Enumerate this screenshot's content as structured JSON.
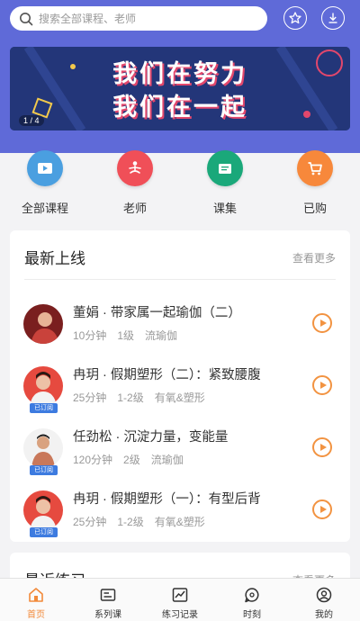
{
  "search": {
    "placeholder": "搜索全部课程、老师"
  },
  "banner": {
    "line1": "我们在努力",
    "line2": "我们在一起",
    "pager": "1 / 4"
  },
  "categories": [
    {
      "label": "全部课程",
      "icon": "video-icon",
      "color": "#4a9fe0"
    },
    {
      "label": "老师",
      "icon": "meditation-icon",
      "color": "#f04f58"
    },
    {
      "label": "课集",
      "icon": "folder-icon",
      "color": "#1aa87a"
    },
    {
      "label": "已购",
      "icon": "cart-icon",
      "color": "#f7883b"
    }
  ],
  "latest": {
    "title": "最新上线",
    "more": "查看更多",
    "items": [
      {
        "title": "董娟 · 带家属一起瑜伽（二）",
        "duration": "10分钟",
        "level": "1级",
        "style": "流瑜伽",
        "badge": ""
      },
      {
        "title": "冉玥 · 假期塑形（二）：紧致腰腹",
        "duration": "25分钟",
        "level": "1-2级",
        "style": "有氧&塑形",
        "badge": "已订阅"
      },
      {
        "title": "任劲松 · 沉淀力量，变能量",
        "duration": "120分钟",
        "level": "2级",
        "style": "流瑜伽",
        "badge": "已订阅"
      },
      {
        "title": "冉玥 · 假期塑形（一）：有型后背",
        "duration": "25分钟",
        "level": "1-2级",
        "style": "有氧&塑形",
        "badge": "已订阅"
      }
    ]
  },
  "recent": {
    "title": "最近练习",
    "more": "查看更多"
  },
  "tabs": [
    {
      "label": "首页",
      "icon": "home-icon",
      "active": true
    },
    {
      "label": "系列课",
      "icon": "series-icon",
      "active": false
    },
    {
      "label": "练习记录",
      "icon": "chart-icon",
      "active": false
    },
    {
      "label": "时刻",
      "icon": "moment-icon",
      "active": false
    },
    {
      "label": "我的",
      "icon": "user-icon",
      "active": false
    }
  ],
  "colors": {
    "primary": "#5f6ad8",
    "accent": "#f29341",
    "badge": "#3d7be0"
  }
}
